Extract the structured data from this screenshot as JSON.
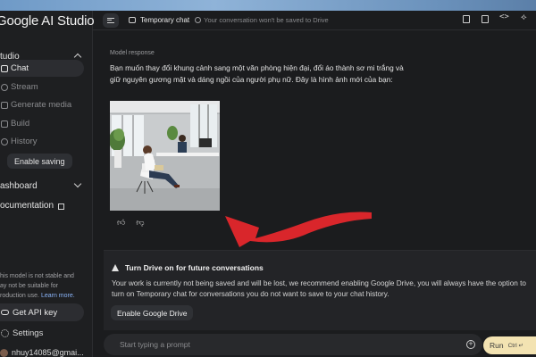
{
  "app": {
    "brand": "Google AI Studio",
    "colors": {
      "background": "#1b1c1e",
      "sidebar": "#1e1f21",
      "accent_link": "#8ab4f8",
      "run_button": "#f3e3b2",
      "arrow": "#d9262b"
    }
  },
  "sidebar": {
    "section_studio": "tudio",
    "items": [
      {
        "label": "Chat",
        "icon": "chat-icon",
        "active": true
      },
      {
        "label": "Stream",
        "icon": "stream-icon",
        "active": false
      },
      {
        "label": "Generate media",
        "icon": "media-icon",
        "active": false
      },
      {
        "label": "Build",
        "icon": "build-icon",
        "active": false
      },
      {
        "label": "History",
        "icon": "history-icon",
        "active": false
      }
    ],
    "enable_saving": "Enable saving",
    "dashboard": "ashboard",
    "documentation": "ocumentation",
    "warning_line1": "his model is not stable and",
    "warning_line2": "ay not be suitable for",
    "warning_line3": "roduction use.",
    "warning_link": "Learn more.",
    "get_api_key": "Get API key",
    "settings": "Settings",
    "user": "nhuy14085@gmai..."
  },
  "header": {
    "title": "Temporary chat",
    "subtitle": "Your conversation won't be saved to Drive",
    "tools": [
      "document-icon",
      "compare-icon",
      "code-icon",
      "spark-icon"
    ]
  },
  "chat": {
    "model_label": "Model response",
    "response_text": "Bạn muốn thay đổi khung cảnh sang một văn phòng hiện đại, đổi áo thành sơ mi trắng và giữ nguyên gương mặt và dáng ngồi của người phụ nữ. Đây là hình ảnh mới của bạn:",
    "feedback": [
      "thumb-up-icon",
      "thumb-down-icon"
    ]
  },
  "drive_card": {
    "title": "Turn Drive on for future conversations",
    "body": "Your work is currently not being saved and will be lost, we recommend enabling Google Drive, you will always have the option to turn on Temporary chat for conversations you do not want to save to your chat history.",
    "button": "Enable Google Drive"
  },
  "prompt": {
    "placeholder": "Start typing a prompt",
    "run_label": "Run",
    "run_shortcut": "Ctrl ↵"
  }
}
